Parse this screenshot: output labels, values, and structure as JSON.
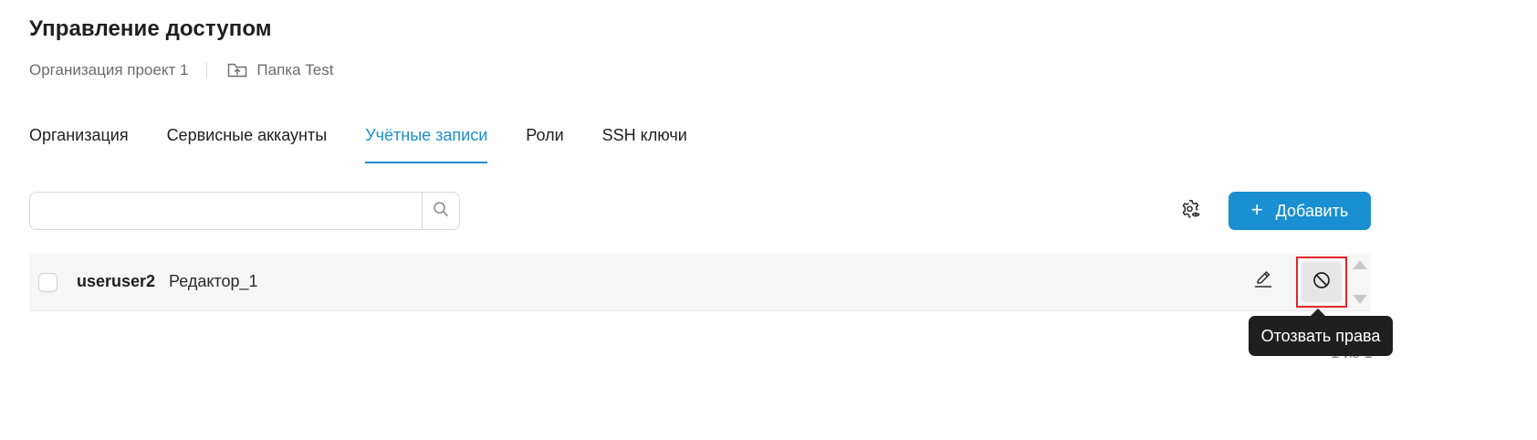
{
  "page": {
    "title": "Управление доступом"
  },
  "breadcrumbs": {
    "organization": "Организация проект 1",
    "folder": "Папка Test",
    "folder_icon": "folder-upload-icon"
  },
  "tabs": [
    {
      "label": "Организация",
      "active": false
    },
    {
      "label": "Сервисные аккаунты",
      "active": false
    },
    {
      "label": "Учётные записи",
      "active": true
    },
    {
      "label": "Роли",
      "active": false
    },
    {
      "label": "SSH ключи",
      "active": false
    }
  ],
  "toolbar": {
    "search_value": "",
    "search_placeholder": "",
    "search_icon": "search-icon",
    "settings_icon": "gear-eye-icon",
    "add_plus": "+",
    "add_label": "Добавить"
  },
  "table": {
    "rows": [
      {
        "user": "useruser2",
        "role": "Редактор_1",
        "checked": false
      }
    ]
  },
  "pagination": {
    "text": "1 из 1"
  },
  "tooltip": {
    "text": "Отозвать права"
  },
  "colors": {
    "accent": "#1a8fd1",
    "highlight": "#e0262b",
    "tooltip_bg": "#1f1f1f"
  }
}
